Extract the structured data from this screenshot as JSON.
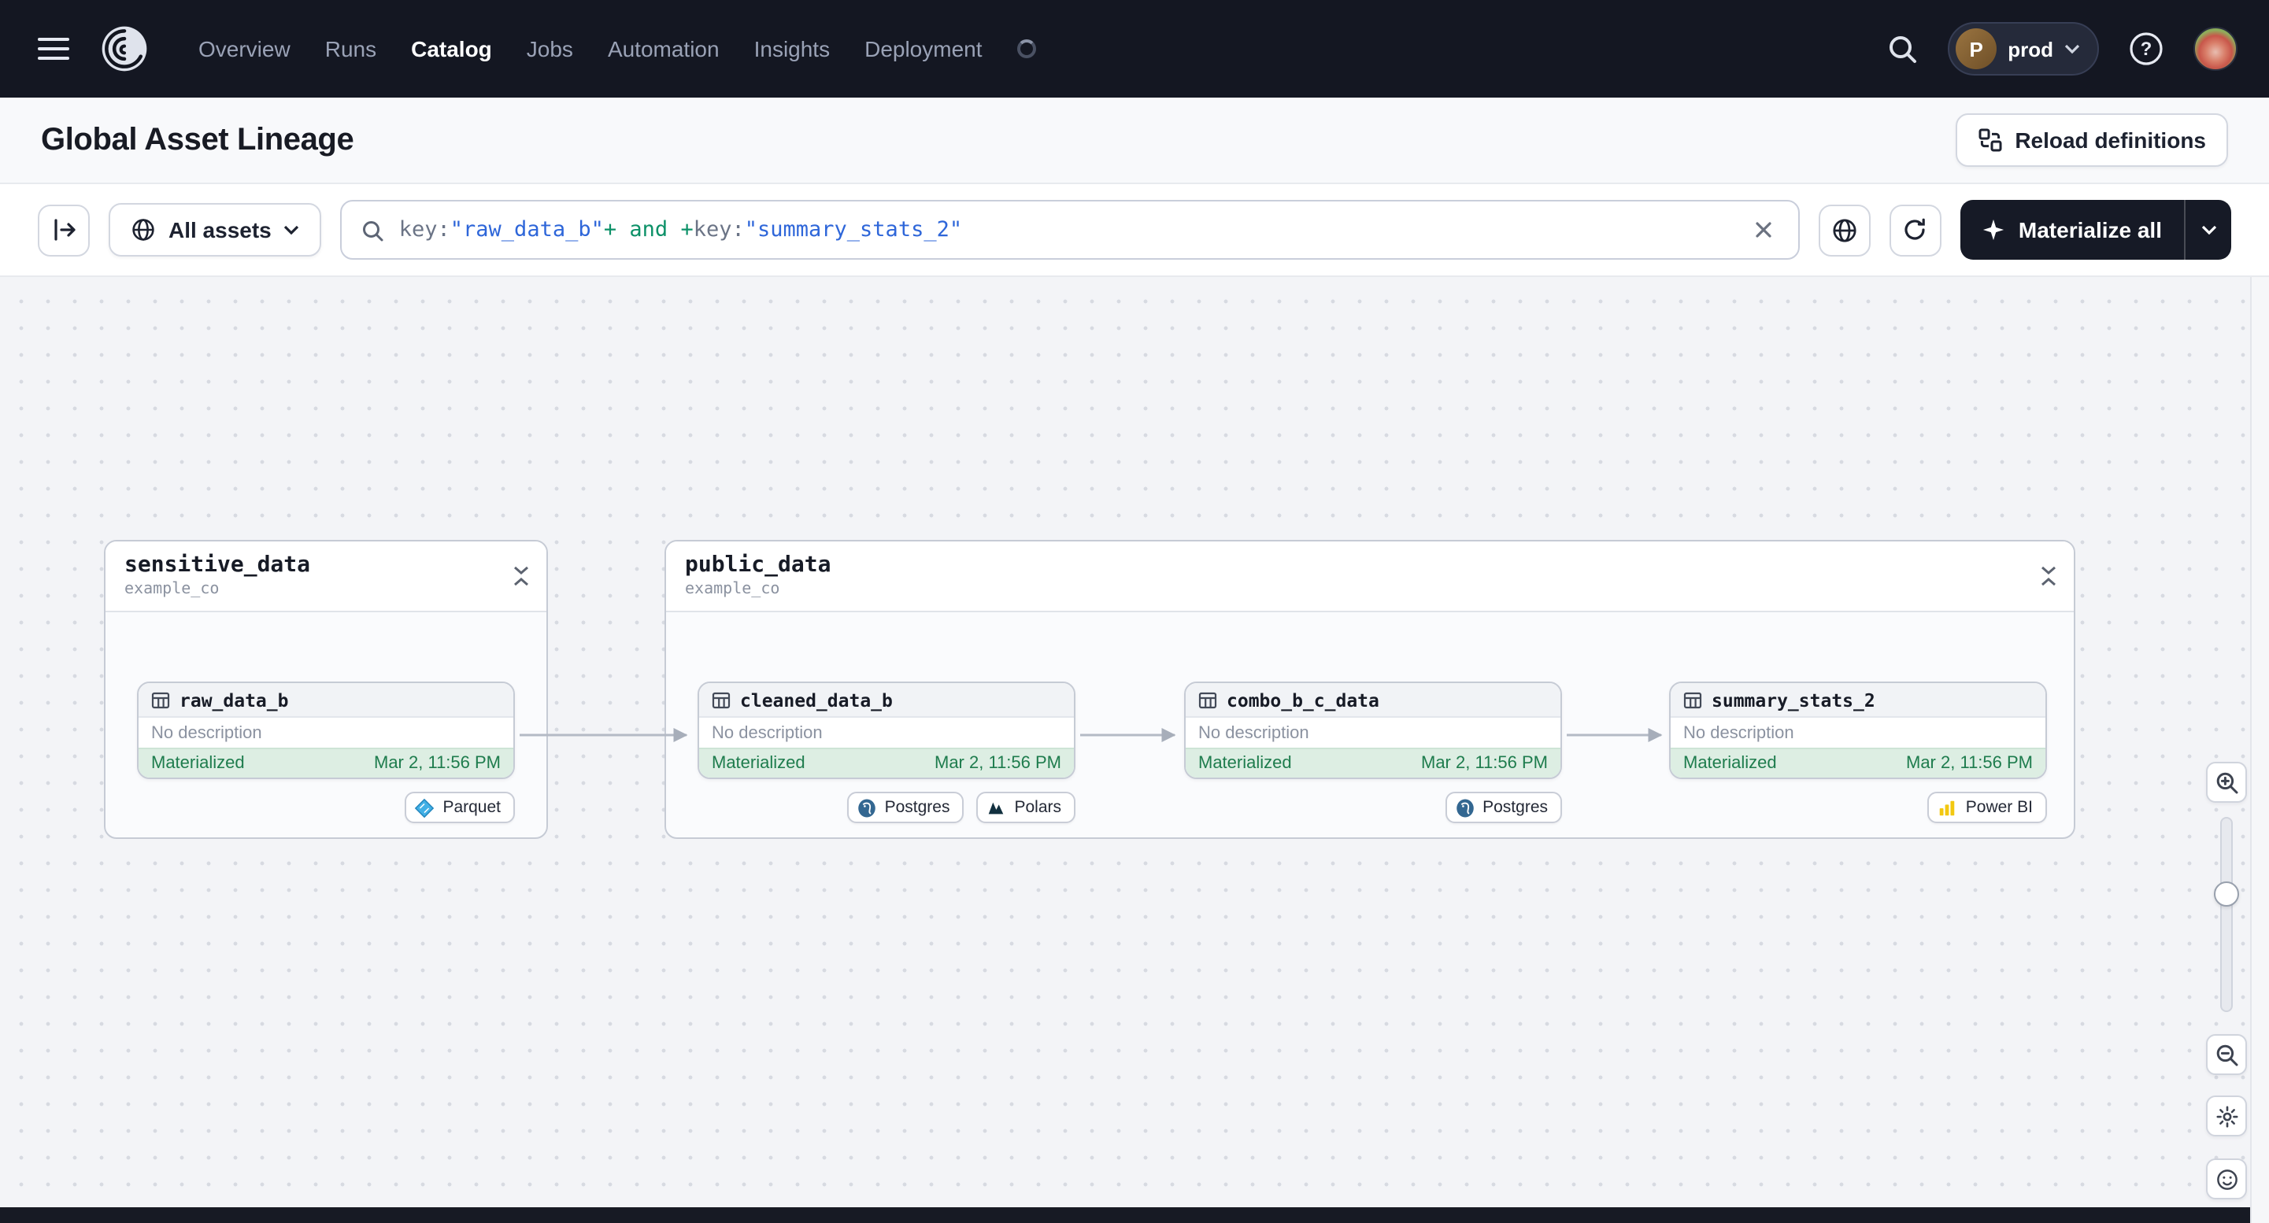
{
  "nav": {
    "items": [
      {
        "label": "Overview",
        "active": false
      },
      {
        "label": "Runs",
        "active": false
      },
      {
        "label": "Catalog",
        "active": true
      },
      {
        "label": "Jobs",
        "active": false
      },
      {
        "label": "Automation",
        "active": false
      },
      {
        "label": "Insights",
        "active": false
      },
      {
        "label": "Deployment",
        "active": false
      }
    ],
    "environment": {
      "label": "prod",
      "avatar_letter": "P"
    }
  },
  "page_header": {
    "title": "Global Asset Lineage",
    "reload_button_label": "Reload definitions"
  },
  "toolbar": {
    "scope_label": "All assets",
    "materialize_label": "Materialize all",
    "query_tokens": [
      {
        "text": "key:",
        "kind": "attribute"
      },
      {
        "text": "\"raw_data_b\"",
        "kind": "string"
      },
      {
        "text": "+",
        "kind": "operator"
      },
      {
        "text": " and ",
        "kind": "keyword"
      },
      {
        "text": "+",
        "kind": "operator"
      },
      {
        "text": "key:",
        "kind": "attribute"
      },
      {
        "text": "\"summary_stats_2\"",
        "kind": "string"
      }
    ]
  },
  "lineage": {
    "groups": [
      {
        "name": "sensitive_data",
        "code_location": "example_co"
      },
      {
        "name": "public_data",
        "code_location": "example_co"
      }
    ],
    "nodes": [
      {
        "name": "raw_data_b",
        "group": "sensitive_data",
        "description": "No description",
        "status": "Materialized",
        "materialized_at": "Mar 2, 11:56 PM",
        "kinds": [
          "Parquet"
        ]
      },
      {
        "name": "cleaned_data_b",
        "group": "public_data",
        "description": "No description",
        "status": "Materialized",
        "materialized_at": "Mar 2, 11:56 PM",
        "kinds": [
          "Postgres",
          "Polars"
        ]
      },
      {
        "name": "combo_b_c_data",
        "group": "public_data",
        "description": "No description",
        "status": "Materialized",
        "materialized_at": "Mar 2, 11:56 PM",
        "kinds": [
          "Postgres"
        ]
      },
      {
        "name": "summary_stats_2",
        "group": "public_data",
        "description": "No description",
        "status": "Materialized",
        "materialized_at": "Mar 2, 11:56 PM",
        "kinds": [
          "Power BI"
        ]
      }
    ],
    "edges": [
      {
        "from": "raw_data_b",
        "to": "cleaned_data_b"
      },
      {
        "from": "cleaned_data_b",
        "to": "combo_b_c_data"
      },
      {
        "from": "combo_b_c_data",
        "to": "summary_stats_2"
      }
    ]
  },
  "colors": {
    "navbar_bg": "#141722",
    "materialized_text": "#1e7c4d",
    "materialized_bg": "#ddeee3",
    "query_string_token": "#2e66d9",
    "query_operator_token": "#0d9168",
    "dark_button_bg": "#161a26"
  }
}
